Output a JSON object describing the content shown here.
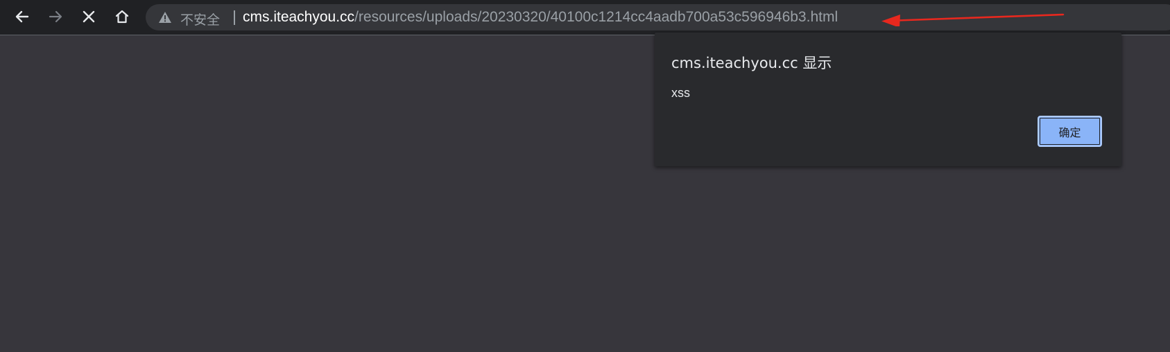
{
  "toolbar": {
    "icons": [
      "back-icon",
      "forward-icon",
      "stop-icon",
      "home-icon"
    ],
    "omnibox": {
      "security_icon": "warning-icon",
      "security_label": "不安全",
      "url_host": "cms.iteachyou.cc",
      "url_path": "/resources/uploads/20230320/40100c1214cc4aadb700a53c596946b3.html"
    }
  },
  "annotation": {
    "color": "#e8281e"
  },
  "alert_dialog": {
    "title": "cms.iteachyou.cc 显示",
    "message": "xss",
    "ok_label": "确定"
  },
  "colors": {
    "toolbar_bg": "#202124",
    "omnibox_bg": "#35363a",
    "page_bg": "#37363c",
    "dialog_bg": "#292a2d",
    "button_accent": "#8ab4f8"
  }
}
